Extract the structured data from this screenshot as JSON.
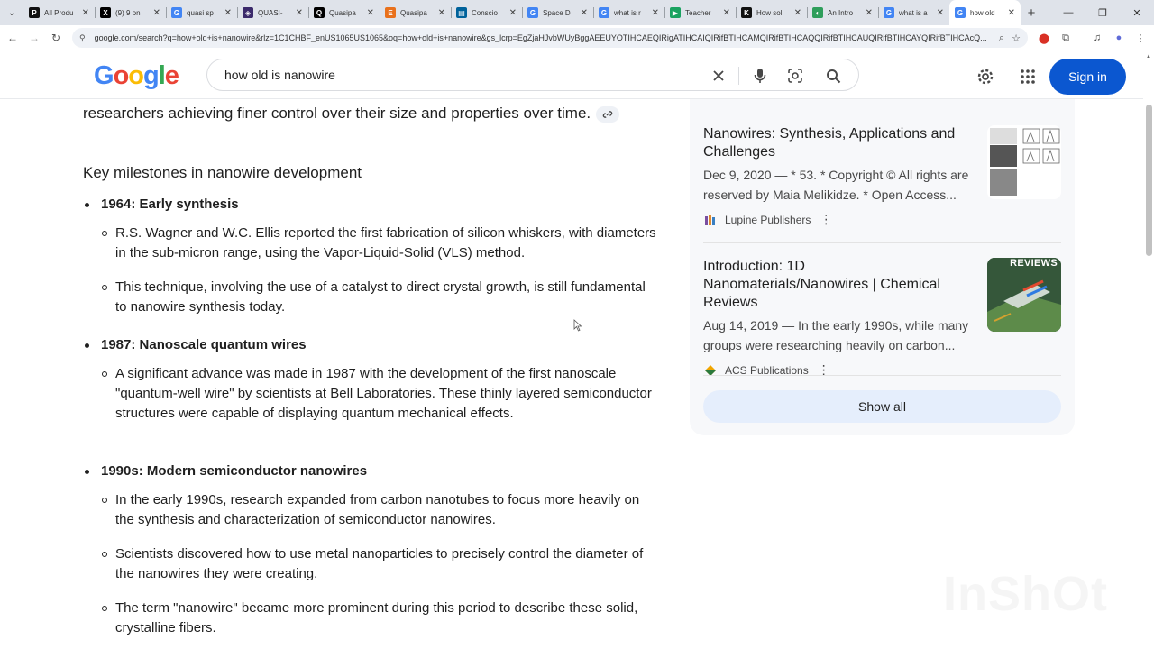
{
  "browser": {
    "tabs": [
      {
        "title": "All Produ",
        "icon": "P",
        "color": "#111111",
        "active": false
      },
      {
        "title": "(9) 9 on",
        "icon": "X",
        "color": "#000000",
        "active": false
      },
      {
        "title": "quasi sp",
        "icon": "G",
        "color": "#4285f4",
        "active": false
      },
      {
        "title": "QUASI-",
        "icon": "◈",
        "color": "#3b2a6b",
        "active": false
      },
      {
        "title": "Quasipa",
        "icon": "Q",
        "color": "#000000",
        "active": false
      },
      {
        "title": "Quasipa",
        "icon": "E",
        "color": "#e9711c",
        "active": false
      },
      {
        "title": "Conscio",
        "icon": "▤",
        "color": "#00629b",
        "active": false
      },
      {
        "title": "Space D",
        "icon": "G",
        "color": "#4285f4",
        "active": false
      },
      {
        "title": "what is r",
        "icon": "G",
        "color": "#4285f4",
        "active": false
      },
      {
        "title": "Teacher",
        "icon": "▶",
        "color": "#1aa260",
        "active": false
      },
      {
        "title": "How sol",
        "icon": "K",
        "color": "#111111",
        "active": false
      },
      {
        "title": "An Intro",
        "icon": "◐",
        "color": "#2e9e5b",
        "active": false
      },
      {
        "title": "what is a",
        "icon": "G",
        "color": "#4285f4",
        "active": false
      },
      {
        "title": "how old",
        "icon": "G",
        "color": "#4285f4",
        "active": true
      }
    ],
    "url": "google.com/search?q=how+old+is+nanowire&rlz=1C1CHBF_enUS1065US1065&oq=how+old+is+nanowire&gs_lcrp=EgZjaHJvbWUyBggAEEUYOTIHCAEQIRigATIHCAIQIRifBTIHCAMQIRifBTIHCAQQIRifBTIHCAUQIRifBTIHCAYQIRifBTIHCAcQ..."
  },
  "search": {
    "logo_letters": [
      "G",
      "o",
      "o",
      "g",
      "l",
      "e"
    ],
    "query": "how old is nanowire",
    "signin_label": "Sign in"
  },
  "content": {
    "intro": "researchers achieving finer control over their size and properties over time.",
    "heading": "Key milestones in nanowire development",
    "milestones": [
      {
        "title": "1964: Early synthesis",
        "points": [
          "R.S. Wagner and W.C. Ellis reported the first fabrication of silicon whiskers, with diameters in the sub-micron range, using the Vapor-Liquid-Solid (VLS) method.",
          "This technique, involving the use of a catalyst to direct crystal growth, is still fundamental to nanowire synthesis today."
        ]
      },
      {
        "title": "1987: Nanoscale quantum wires",
        "points": [
          "A significant advance was made in 1987 with the development of the first nanoscale \"quantum-well wire\" by scientists at Bell Laboratories. These thinly layered semiconductor structures were capable of displaying quantum mechanical effects."
        ]
      },
      {
        "title": "1990s: Modern semiconductor nanowires",
        "points": [
          "In the early 1990s, research expanded from carbon nanotubes to focus more heavily on the synthesis and characterization of semiconductor nanowires.",
          "Scientists discovered how to use metal nanoparticles to precisely control the diameter of the nanowires they were creating.",
          "The term \"nanowire\" became more prominent during this period to describe these solid, crystalline fibers."
        ]
      }
    ]
  },
  "panel": {
    "cards": [
      {
        "title": "Nanowires: Synthesis, Applications and Challenges",
        "snippet": "Dec 9, 2020 — * 53. * Copyright © All rights are reserved by Maia Melikidze. * Open Access...",
        "source": "Lupine Publishers"
      },
      {
        "title": "Introduction: 1D Nanomaterials/Nanowires | Chemical Reviews",
        "snippet": "Aug 14, 2019 — In the early 1990s, while many groups were researching heavily on carbon...",
        "source": "ACS Publications",
        "thumb_label": "REVIEWS"
      }
    ],
    "show_all_label": "Show all"
  },
  "watermark": "InShOt"
}
